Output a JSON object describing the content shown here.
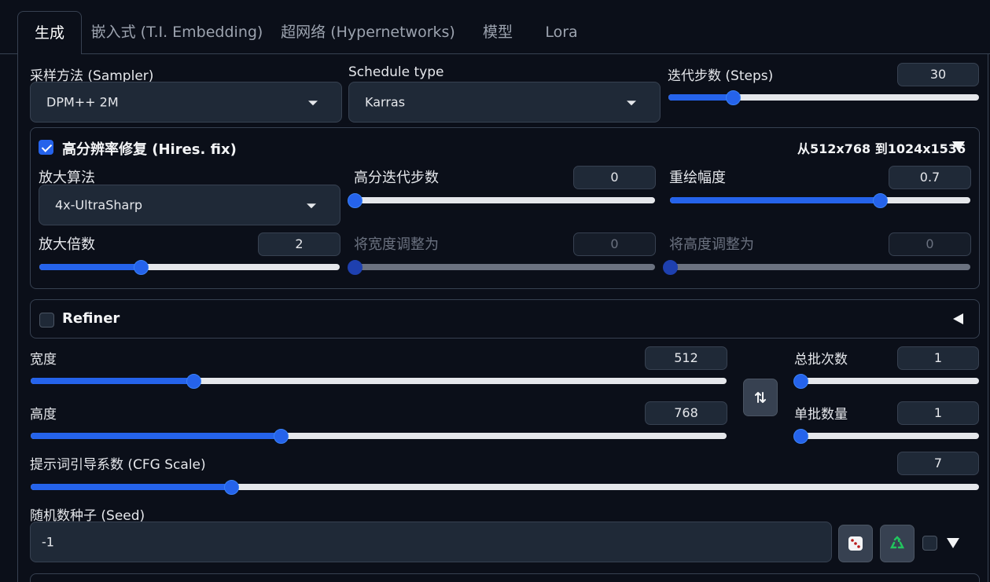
{
  "tabs": [
    {
      "label": "生成",
      "active": true
    },
    {
      "label": "嵌入式 (T.I. Embedding)",
      "active": false
    },
    {
      "label": "超网络 (Hypernetworks)",
      "active": false
    },
    {
      "label": "模型",
      "active": false
    },
    {
      "label": "Lora",
      "active": false
    }
  ],
  "sampler": {
    "label": "采样方法 (Sampler)",
    "value": "DPM++ 2M"
  },
  "schedule": {
    "label": "Schedule type",
    "value": "Karras"
  },
  "steps": {
    "label": "迭代步数 (Steps)",
    "value": "30",
    "fraction": 0.21
  },
  "hires": {
    "label": "高分辨率修复 (Hires. fix)",
    "checked": true,
    "summary": "从512x768 到1024x1536",
    "upscaler": {
      "label": "放大算法",
      "value": "4x-UltraSharp"
    },
    "hires_steps": {
      "label": "高分迭代步数",
      "value": "0",
      "fraction": 0.0
    },
    "denoise": {
      "label": "重绘幅度",
      "value": "0.7",
      "fraction": 0.7
    },
    "scale": {
      "label": "放大倍数",
      "value": "2",
      "fraction": 0.34
    },
    "resize_w": {
      "label": "将宽度调整为",
      "value": "0",
      "fraction": 0.0
    },
    "resize_h": {
      "label": "将高度调整为",
      "value": "0",
      "fraction": 0.0
    }
  },
  "refiner": {
    "label": "Refiner",
    "checked": false
  },
  "width": {
    "label": "宽度",
    "value": "512",
    "fraction": 0.234
  },
  "height": {
    "label": "高度",
    "value": "768",
    "fraction": 0.36
  },
  "batch_count": {
    "label": "总批次数",
    "value": "1",
    "fraction": 0.0
  },
  "batch_size": {
    "label": "单批数量",
    "value": "1",
    "fraction": 0.0
  },
  "cfg": {
    "label": "提示词引导系数 (CFG Scale)",
    "value": "7",
    "fraction": 0.212
  },
  "seed": {
    "label": "随机数种子 (Seed)",
    "value": "-1"
  },
  "icons": {
    "swap": "swap-dimensions-icon",
    "dice": "dice-icon",
    "recycle": "recycle-icon"
  },
  "colors": {
    "accent": "#2563eb",
    "background": "#0b0f19",
    "panel": "#1f2937"
  }
}
